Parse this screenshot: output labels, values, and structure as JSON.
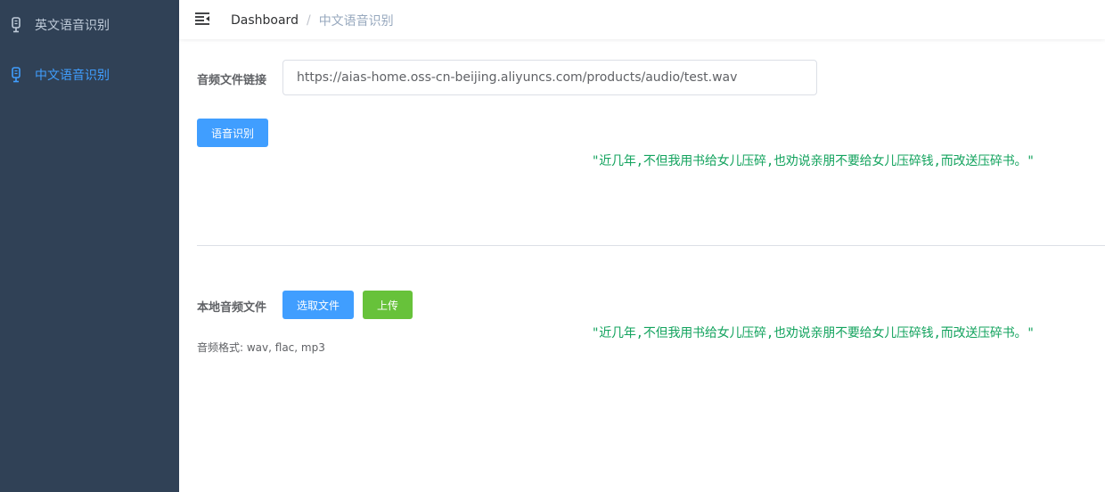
{
  "sidebar": {
    "items": [
      {
        "label": "英文语音识别",
        "icon": "microphone-icon",
        "active": false
      },
      {
        "label": "中文语音识别",
        "icon": "microphone-icon",
        "active": true
      }
    ]
  },
  "navbar": {
    "breadcrumb": {
      "root": "Dashboard",
      "separator": "/",
      "current": "中文语音识别"
    }
  },
  "url_form": {
    "label": "音频文件链接",
    "value": "https://aias-home.oss-cn-beijing.aliyuncs.com/products/audio/test.wav",
    "button_label": "语音识别",
    "result": "\"近几年,不但我用书给女儿压碎,也劝说亲朋不要给女儿压碎钱,而改送压碎书。\""
  },
  "local_form": {
    "label": "本地音频文件",
    "select_button_label": "选取文件",
    "upload_button_label": "上传",
    "hint": "音频格式: wav, flac, mp3",
    "result": "\"近几年,不但我用书给女儿压碎,也劝说亲朋不要给女儿压碎钱,而改送压碎书。\""
  },
  "colors": {
    "sidebar_bg": "#304156",
    "sidebar_text": "#bfcbd9",
    "accent": "#409eff",
    "success": "#67c23a",
    "result_text": "#13a35e"
  }
}
